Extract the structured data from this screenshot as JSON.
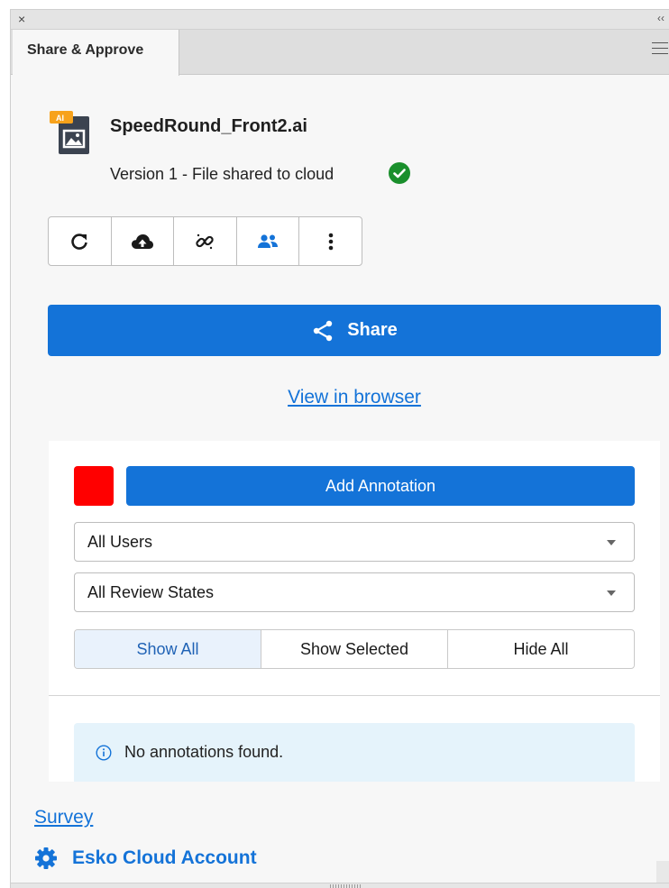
{
  "panel": {
    "close_glyph": "×",
    "collapse_glyph": "‹‹",
    "tab_title": "Share & Approve"
  },
  "file": {
    "badge": "AI",
    "name": "SpeedRound_Front2.ai",
    "version_status": "Version 1 - File shared to cloud",
    "status_icon": "check-circle-icon",
    "status_color": "#1a8f2c"
  },
  "toolbar": {
    "icons": [
      "refresh-icon",
      "cloud-upload-icon",
      "unlink-icon",
      "users-icon",
      "more-vertical-icon"
    ]
  },
  "share": {
    "label": "Share",
    "color": "#1473d8"
  },
  "view_in_browser": "View in browser",
  "annotations": {
    "swatch_color": "#ff0000",
    "add_label": "Add Annotation",
    "user_filter": "All Users",
    "state_filter": "All Review States",
    "segments": [
      "Show All",
      "Show Selected",
      "Hide All"
    ],
    "active_segment": "Show All",
    "empty_message": "No annotations found."
  },
  "footer": {
    "survey": "Survey",
    "account": "Esko Cloud Account"
  }
}
